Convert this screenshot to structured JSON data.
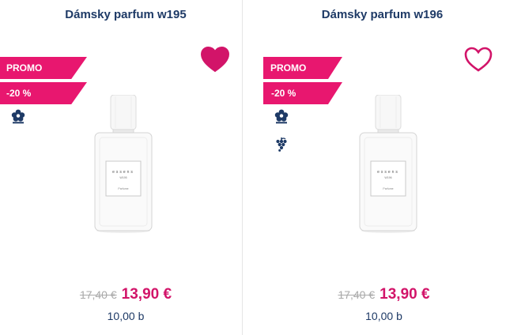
{
  "colors": {
    "brand_navy": "#1e3a66",
    "promo_pink": "#e8176f",
    "price_pink": "#d21469",
    "old_price_gray": "#a9a9a9"
  },
  "products": [
    {
      "title": "Dámsky parfum w195",
      "badges": {
        "promo": "PROMO",
        "discount": "-20 %"
      },
      "features": [
        "flower-icon"
      ],
      "favorite": true,
      "bottle": {
        "brand_text": "essens",
        "model_text": "W195",
        "type_text": "Parfume"
      },
      "old_price": "17,40 €",
      "new_price": "13,90 €",
      "points": "10,00 b"
    },
    {
      "title": "Dámsky parfum w196",
      "badges": {
        "promo": "PROMO",
        "discount": "-20 %"
      },
      "features": [
        "flower-icon",
        "grapes-icon"
      ],
      "favorite": false,
      "bottle": {
        "brand_text": "essens",
        "model_text": "W196",
        "type_text": "Parfume"
      },
      "old_price": "17,40 €",
      "new_price": "13,90 €",
      "points": "10,00 b"
    }
  ]
}
